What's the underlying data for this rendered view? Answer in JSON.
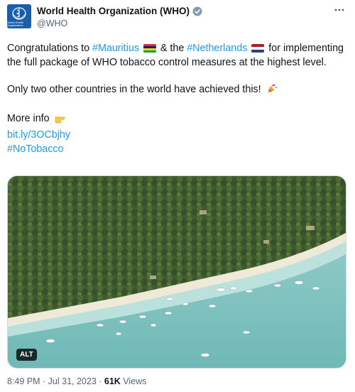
{
  "account": {
    "name": "World Health Organization (WHO)",
    "handle": "@WHO",
    "logo_text": "World Health Organization"
  },
  "tweet": {
    "line1_prefix": "Congratulations to ",
    "hashtag_mauritius": "#Mauritius",
    "connector": " & the ",
    "hashtag_netherlands": "#Netherlands",
    "line1_suffix": " for implementing the full package of WHO tobacco control measures at the highest level.",
    "line2": "Only two other countries in the world have achieved this!",
    "more_info": "More info",
    "link": "bit.ly/3OCbjhy",
    "hashtag_notobacco": "#NoTobacco"
  },
  "media": {
    "alt_label": "ALT"
  },
  "meta": {
    "time": "8:49 PM",
    "separator": " · ",
    "date": "Jul 31, 2023",
    "views_count": "61K",
    "views_label": " Views"
  },
  "icons": {
    "verified": "verified-badge-icon",
    "more": "more-options-icon",
    "party": "party-popper-icon",
    "pointing": "pointing-hand-icon"
  },
  "colors": {
    "link": "#1d9bf0",
    "secondary_text": "#536471",
    "who_blue": "#1a5eab"
  }
}
